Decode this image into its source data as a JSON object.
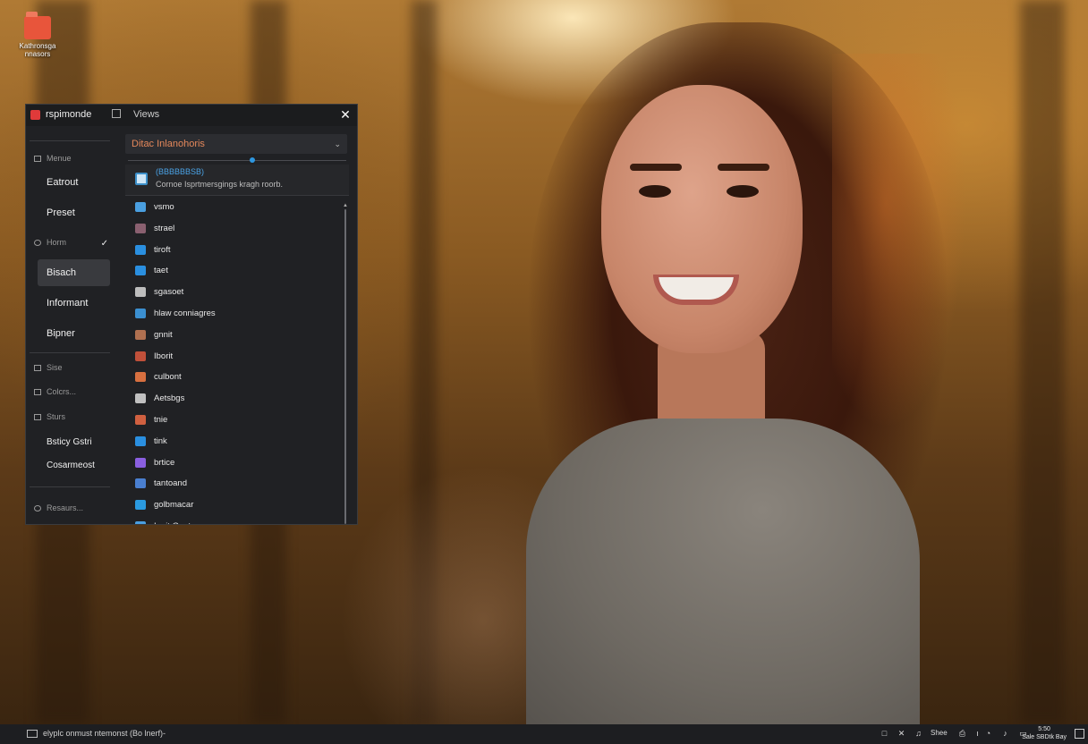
{
  "desktop": {
    "icon_label": "Kathronsga nnasors"
  },
  "window": {
    "app_title": "rspimonde",
    "view_label": "Views",
    "close_glyph": "✕"
  },
  "sidebar": {
    "section_1": "Menue",
    "items_1": [
      "Eatrout",
      "Preset"
    ],
    "section_2": "Horm",
    "items_2": [
      "Bisach",
      "Informant",
      "Bipner"
    ],
    "section_3": "Sise",
    "section_4": "Colcrs...",
    "section_5": "Sturs",
    "items_3": [
      "Bsticy Gstri",
      "Cosarmeost"
    ],
    "footer": "Resaurs..."
  },
  "main": {
    "dropdown_value": "Ditac Inlanohoris",
    "info_link": "(BBBBBBSB)",
    "info_desc": "Cornoe Isprtmersgings kragh roorb."
  },
  "list": [
    {
      "label": "vsmo",
      "color": "#4a9fe0"
    },
    {
      "label": "strael",
      "color": "#8a6070"
    },
    {
      "label": "tiroft",
      "color": "#2a8fe0"
    },
    {
      "label": "taet",
      "color": "#2a8fe0"
    },
    {
      "label": "sgasoet",
      "color": "#bdbdbd"
    },
    {
      "label": "hlaw conniagres",
      "color": "#3b8fd0"
    },
    {
      "label": "gnnit",
      "color": "#b07050"
    },
    {
      "label": "Iborit",
      "color": "#c0503a"
    },
    {
      "label": "culbont",
      "color": "#d87040"
    },
    {
      "label": "Aetsbgs",
      "color": "#c0c0c0"
    },
    {
      "label": "tnie",
      "color": "#d06040"
    },
    {
      "label": "tink",
      "color": "#2a8fe0"
    },
    {
      "label": "brtice",
      "color": "#8a5fe0"
    },
    {
      "label": "tantoand",
      "color": "#4a7fd0"
    },
    {
      "label": "golbmacar",
      "color": "#2a9ae0"
    },
    {
      "label": "Innit Geat",
      "color": "#4a9fe0"
    }
  ],
  "taskbar": {
    "text": "elyplc onmust ntemonst (Bo lnerf)-",
    "tray_label": "Shee",
    "clock_time": "5:50",
    "clock_date": "Sale SBDtk Bay"
  }
}
